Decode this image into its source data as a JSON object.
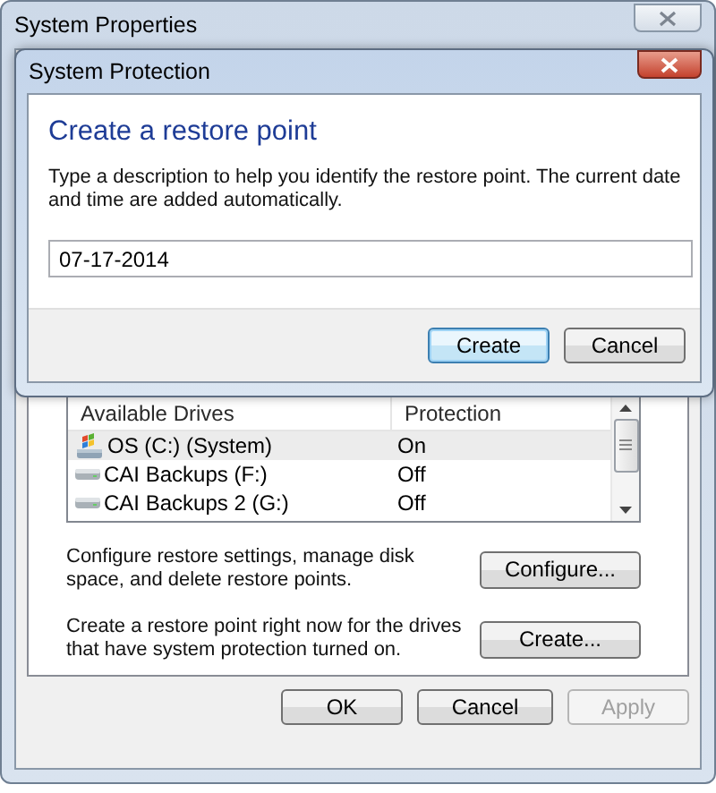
{
  "window": {
    "title": "System Properties"
  },
  "drive_list": {
    "columns": [
      "Available Drives",
      "Protection"
    ],
    "rows": [
      {
        "name": "OS (C:) (System)",
        "protection": "On",
        "kind": "system",
        "selected": true
      },
      {
        "name": "CAI Backups (F:)",
        "protection": "Off",
        "kind": "drive",
        "selected": false
      },
      {
        "name": "CAI Backups 2 (G:)",
        "protection": "Off",
        "kind": "drive",
        "selected": false
      }
    ]
  },
  "actions": [
    {
      "text": "Configure restore settings, manage disk space, and delete restore points.",
      "button": "Configure..."
    },
    {
      "text": "Create a restore point right now for the drives that have system protection turned on.",
      "button": "Create..."
    }
  ],
  "buttons": [
    {
      "label": "OK",
      "disabled": false
    },
    {
      "label": "Cancel",
      "disabled": false
    },
    {
      "label": "Apply",
      "disabled": true
    }
  ],
  "dialog": {
    "title": "System Protection",
    "heading": "Create a restore point",
    "description": "Type a description to help you identify the restore point. The current date and time are added automatically.",
    "field": {
      "value": "07-17-2014"
    },
    "buttons": [
      {
        "label": "Create",
        "default": true
      },
      {
        "label": "Cancel",
        "default": false
      }
    ]
  }
}
